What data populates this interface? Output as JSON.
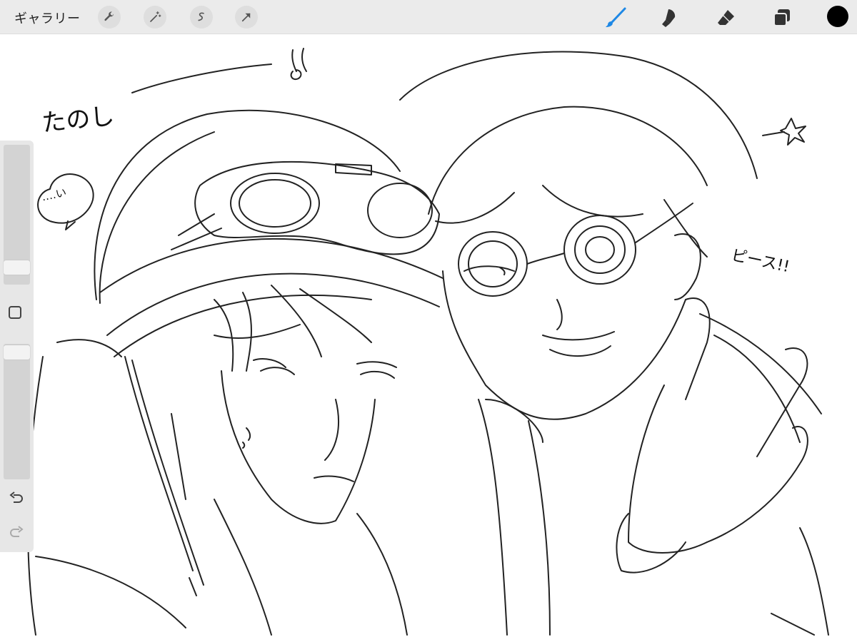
{
  "toolbar": {
    "gallery_label": "ギャラリー",
    "left_tools": [
      "wrench-icon",
      "magic-wand-icon",
      "selection-icon",
      "transform-arrow-icon"
    ],
    "right_tools": [
      "brush-icon",
      "smudge-icon",
      "eraser-icon",
      "layers-icon"
    ],
    "active_tool": "brush",
    "accent_color": "#1e88e5",
    "current_color": "#000000"
  },
  "sidebar": {
    "brush_size_level": 0.9,
    "opacity_level": 0.05,
    "icons": [
      "modify-square-icon",
      "undo-icon",
      "redo-icon"
    ]
  },
  "canvas": {
    "notes": {
      "fun": "たのし",
      "speech": "‥‥い",
      "peace": "ピース!!"
    }
  }
}
